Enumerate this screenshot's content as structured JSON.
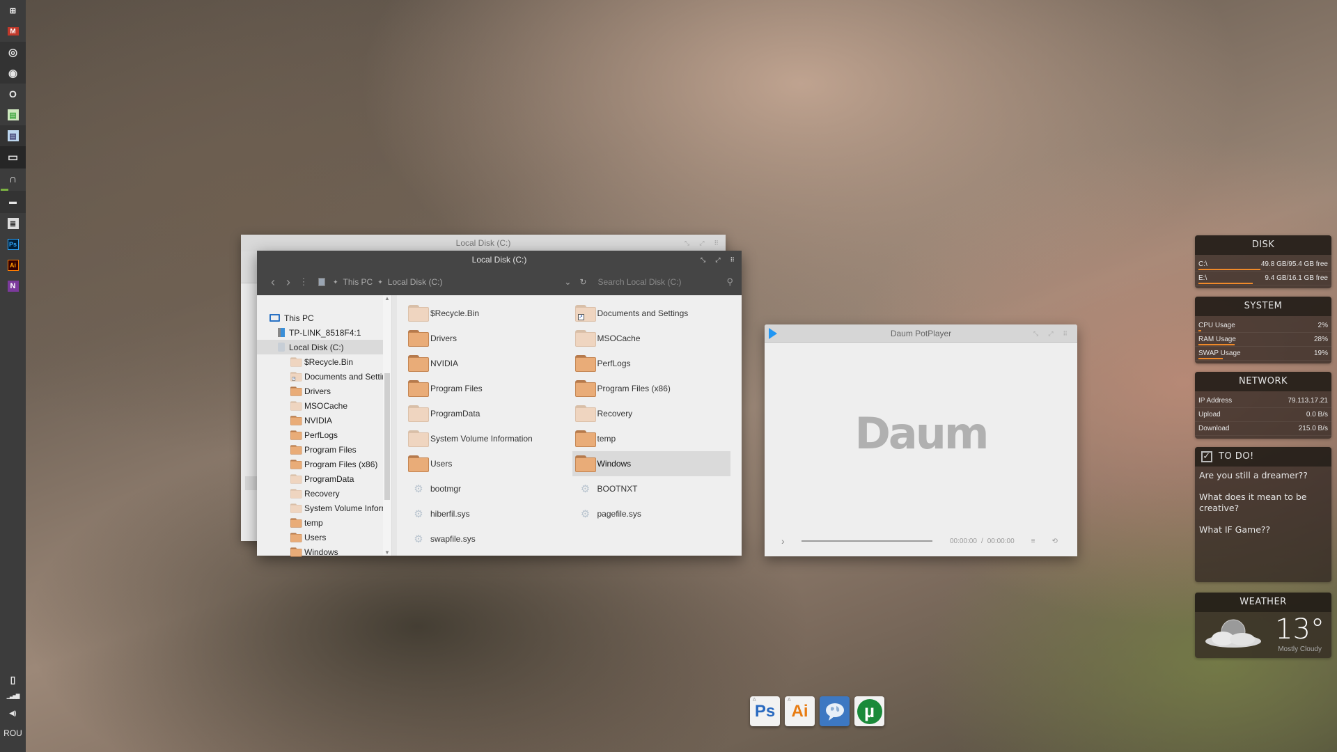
{
  "taskbar": {
    "items": [
      {
        "name": "windows-start-icon",
        "glyph": "⊞"
      },
      {
        "name": "gmail-icon",
        "glyph": "M"
      },
      {
        "name": "chrome-icon",
        "glyph": "◎"
      },
      {
        "name": "firefox-icon",
        "glyph": "◉"
      },
      {
        "name": "opera-icon",
        "glyph": "O"
      },
      {
        "name": "app-green-icon",
        "glyph": "▤"
      },
      {
        "name": "app-blue-icon",
        "glyph": "▤"
      },
      {
        "name": "computer-icon",
        "glyph": "▭"
      },
      {
        "name": "headphones-icon",
        "glyph": "∩"
      },
      {
        "name": "clapperboard-icon",
        "glyph": "▬"
      },
      {
        "name": "notepad-icon",
        "glyph": "≣"
      },
      {
        "name": "photoshop-icon",
        "glyph": "Ps"
      },
      {
        "name": "illustrator-icon",
        "glyph": "Ai"
      },
      {
        "name": "onenote-icon",
        "glyph": "N"
      }
    ],
    "tray": {
      "battery_glyph": "▯",
      "signal_glyph": "▁▃▅▇",
      "volume_glyph": "◀)",
      "language": "ROU"
    }
  },
  "explorer_back": {
    "title": "Local Disk (C:)",
    "controls": [
      "⤡",
      "⤢",
      "⠿"
    ]
  },
  "explorer": {
    "title": "Local Disk (C:)",
    "controls": [
      "⤡",
      "⤢",
      "⠿"
    ],
    "nav": {
      "back": "‹",
      "forward": "›",
      "up": "⋮"
    },
    "breadcrumb": [
      "This PC",
      "Local Disk (C:)"
    ],
    "breadcrumb_sep": "✦",
    "dropdown_glyph": "⌄",
    "refresh_glyph": "↻",
    "search_placeholder": "Search Local Disk (C:)",
    "search_glyph": "⚲",
    "tree": [
      {
        "label": "This PC",
        "type": "pc",
        "level": 0
      },
      {
        "label": "TP-LINK_8518F4:1",
        "type": "network",
        "level": 1
      },
      {
        "label": "Local Disk (C:)",
        "type": "drive",
        "level": 1,
        "selected": true
      },
      {
        "label": "$Recycle.Bin",
        "type": "folder-empty",
        "level": 2
      },
      {
        "label": "Documents and Settings",
        "type": "shortcut",
        "level": 2
      },
      {
        "label": "Drivers",
        "type": "folder",
        "level": 2
      },
      {
        "label": "MSOCache",
        "type": "folder-empty",
        "level": 2
      },
      {
        "label": "NVIDIA",
        "type": "folder",
        "level": 2
      },
      {
        "label": "PerfLogs",
        "type": "folder",
        "level": 2
      },
      {
        "label": "Program Files",
        "type": "folder",
        "level": 2
      },
      {
        "label": "Program Files (x86)",
        "type": "folder",
        "level": 2
      },
      {
        "label": "ProgramData",
        "type": "folder-empty",
        "level": 2
      },
      {
        "label": "Recovery",
        "type": "folder-empty",
        "level": 2
      },
      {
        "label": "System Volume Information",
        "type": "folder-empty",
        "level": 2
      },
      {
        "label": "temp",
        "type": "folder",
        "level": 2
      },
      {
        "label": "Users",
        "type": "folder",
        "level": 2
      },
      {
        "label": "Windows",
        "type": "folder",
        "level": 2
      }
    ],
    "files": [
      {
        "label": "$Recycle.Bin",
        "type": "folder-empty"
      },
      {
        "label": "Documents and Settings",
        "type": "shortcut"
      },
      {
        "label": "Drivers",
        "type": "folder"
      },
      {
        "label": "MSOCache",
        "type": "folder-empty"
      },
      {
        "label": "NVIDIA",
        "type": "folder"
      },
      {
        "label": "PerfLogs",
        "type": "folder"
      },
      {
        "label": "Program Files",
        "type": "folder"
      },
      {
        "label": "Program Files (x86)",
        "type": "folder"
      },
      {
        "label": "ProgramData",
        "type": "folder-empty"
      },
      {
        "label": "Recovery",
        "type": "folder-empty"
      },
      {
        "label": "System Volume Information",
        "type": "folder-empty"
      },
      {
        "label": "temp",
        "type": "folder"
      },
      {
        "label": "Users",
        "type": "folder"
      },
      {
        "label": "Windows",
        "type": "folder",
        "selected": true
      },
      {
        "label": "bootmgr",
        "type": "system"
      },
      {
        "label": "BOOTNXT",
        "type": "system"
      },
      {
        "label": "hiberfil.sys",
        "type": "system"
      },
      {
        "label": "pagefile.sys",
        "type": "system"
      },
      {
        "label": "swapfile.sys",
        "type": "system"
      }
    ]
  },
  "player": {
    "title": "Daum PotPlayer",
    "controls": [
      "⤡",
      "⤢",
      "⠿"
    ],
    "logo": "Daum",
    "play_glyph": "›",
    "progress": 0,
    "time_current": "00:00:00",
    "time_sep": "/",
    "time_total": "00:00:00",
    "playlist_glyph": "≡",
    "loop_glyph": "⟲"
  },
  "widgets": {
    "disk": {
      "title": "DISK",
      "rows": [
        {
          "label": "C:\\",
          "value": "49.8 GB/95.4 GB free",
          "fill": 0.48
        },
        {
          "label": "E:\\",
          "value": "9.4 GB/16.1 GB free",
          "fill": 0.42
        }
      ]
    },
    "system": {
      "title": "SYSTEM",
      "rows": [
        {
          "label": "CPU Usage",
          "value": "2%",
          "fill": 0.02
        },
        {
          "label": "RAM Usage",
          "value": "28%",
          "fill": 0.28
        },
        {
          "label": "SWAP Usage",
          "value": "19%",
          "fill": 0.19
        }
      ]
    },
    "network": {
      "title": "NETWORK",
      "rows": [
        {
          "label": "IP Address",
          "value": "79.113.17.21"
        },
        {
          "label": "Upload",
          "value": "0.0 B/s"
        },
        {
          "label": "Download",
          "value": "215.0 B/s"
        }
      ]
    },
    "todo": {
      "title": "TO DO!",
      "check_glyph": "✓",
      "items": [
        "Are you still a dreamer??",
        "What does it mean to be creative?",
        "What IF Game??"
      ]
    },
    "weather": {
      "title": "WEATHER",
      "temperature": "13°",
      "condition": "Mostly Cloudy"
    }
  },
  "dock": {
    "items": [
      {
        "name": "photoshop",
        "label": "Ps",
        "color": "#2a6ac0"
      },
      {
        "name": "illustrator",
        "label": "Ai",
        "color": "#e87c12"
      },
      {
        "name": "chat-globe",
        "label": "",
        "color": "#3d78c2"
      },
      {
        "name": "utorrent",
        "label": "µ",
        "color": "#1a8a3a"
      }
    ],
    "adobe_mark": "A"
  },
  "colors": {
    "accent_orange": "#f08a2a",
    "potplayer_blue": "#2196f3",
    "taskbar_bg": "#3c3c3c",
    "active_indicator": "#7cb342"
  }
}
